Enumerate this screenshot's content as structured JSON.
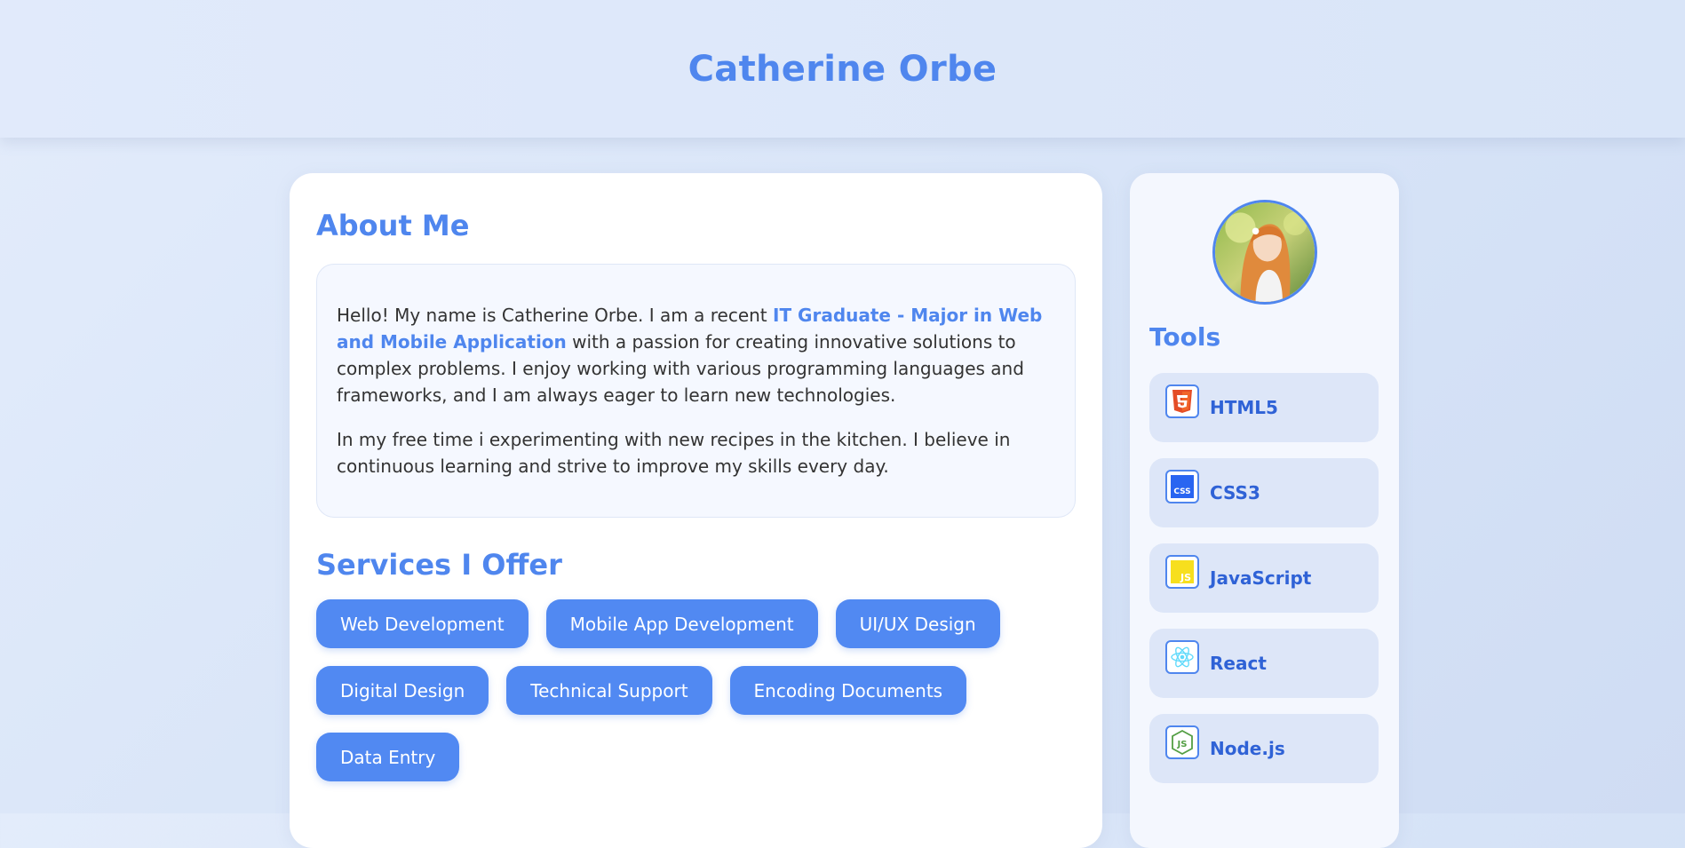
{
  "header": {
    "name": "Catherine Orbe"
  },
  "about": {
    "title": "About Me",
    "p1_before": "Hello! My name is Catherine Orbe. I am a recent ",
    "p1_highlight": "IT Graduate - Major in Web and Mobile Application",
    "p1_after": " with a passion for creating innovative solutions to complex problems. I enjoy working with various programming languages and frameworks, and I am always eager to learn new technologies.",
    "p2": "In my free time i experimenting with new recipes in the kitchen. I believe in continuous learning and strive to improve my skills every day."
  },
  "services": {
    "title": "Services I Offer",
    "items": [
      "Web Development",
      "Mobile App Development",
      "UI/UX Design",
      "Digital Design",
      "Technical Support",
      "Encoding Documents",
      "Data Entry"
    ]
  },
  "sidebar": {
    "tools_title": "Tools",
    "tools": [
      {
        "label": "HTML5",
        "icon": "html5-icon"
      },
      {
        "label": "CSS3",
        "icon": "css3-icon"
      },
      {
        "label": "JavaScript",
        "icon": "javascript-icon"
      },
      {
        "label": "React",
        "icon": "react-icon"
      },
      {
        "label": "Node.js",
        "icon": "nodejs-icon"
      }
    ]
  },
  "colors": {
    "accent": "#4f86ee",
    "chip": "#5189f2",
    "tool_text": "#2f62d6"
  }
}
